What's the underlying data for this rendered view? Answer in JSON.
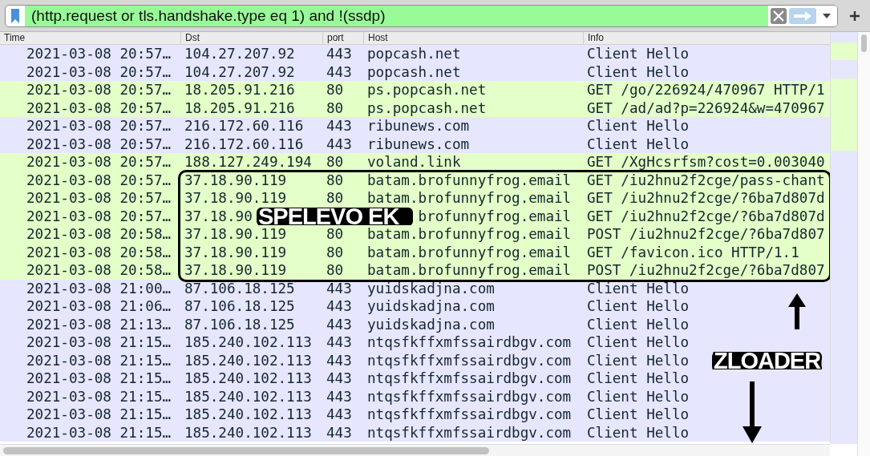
{
  "filter_bar": {
    "value": "(http.request or tls.handshake.type eq 1) and !(ssdp)"
  },
  "table": {
    "columns": [
      "Time",
      "Dst",
      "port",
      "Host",
      "Info"
    ],
    "rows": [
      {
        "color": "#e7e6ff",
        "cells": [
          "2021-03-08 20:57…",
          "104.27.207.92",
          "443",
          "popcash.net",
          "Client Hello"
        ]
      },
      {
        "color": "#e7e6ff",
        "cells": [
          "2021-03-08 20:57…",
          "104.27.207.92",
          "443",
          "popcash.net",
          "Client Hello"
        ]
      },
      {
        "color": "#e4ffc7",
        "cells": [
          "2021-03-08 20:57…",
          "18.205.91.216",
          "80",
          "ps.popcash.net",
          "GET /go/226924/470967 HTTP/1"
        ]
      },
      {
        "color": "#e4ffc7",
        "cells": [
          "2021-03-08 20:57…",
          "18.205.91.216",
          "80",
          "ps.popcash.net",
          "GET /ad/ad?p=226924&w=470967"
        ]
      },
      {
        "color": "#e7e6ff",
        "cells": [
          "2021-03-08 20:57…",
          "216.172.60.116",
          "443",
          "ribunews.com",
          "Client Hello"
        ]
      },
      {
        "color": "#e7e6ff",
        "cells": [
          "2021-03-08 20:57…",
          "216.172.60.116",
          "443",
          "ribunews.com",
          "Client Hello"
        ]
      },
      {
        "color": "#e4ffc7",
        "cells": [
          "2021-03-08 20:57…",
          "188.127.249.194",
          "80",
          "voland.link",
          "GET /XgHcsrfsm?cost=0.003040"
        ]
      },
      {
        "color": "#e4ffc7",
        "cells": [
          "2021-03-08 20:57…",
          "37.18.90.119",
          "80",
          "batam.brofunnyfrog.email",
          "GET /iu2hnu2f2cge/pass-chant"
        ]
      },
      {
        "color": "#e4ffc7",
        "cells": [
          "2021-03-08 20:57…",
          "37.18.90.119",
          "80",
          "batam.brofunnyfrog.email",
          "GET /iu2hnu2f2cge/?6ba7d807d"
        ]
      },
      {
        "color": "#e4ffc7",
        "cells": [
          "2021-03-08 20:57…",
          "37.18.90",
          null,
          "brofunnyfrog.email",
          "GET /iu2hnu2f2cge/?6ba7d807d"
        ]
      },
      {
        "color": "#e4ffc7",
        "cells": [
          "2021-03-08 20:58…",
          "37.18.90.119",
          "80",
          "batam.brofunnyfrog.email",
          "POST /iu2hnu2f2cge/?6ba7d807"
        ]
      },
      {
        "color": "#e4ffc7",
        "cells": [
          "2021-03-08 20:58…",
          "37.18.90.119",
          "80",
          "batam.brofunnyfrog.email",
          "GET /favicon.ico HTTP/1.1"
        ]
      },
      {
        "color": "#e4ffc7",
        "cells": [
          "2021-03-08 20:58…",
          "37.18.90.119",
          "80",
          "batam.brofunnyfrog.email",
          "POST /iu2hnu2f2cge/?6ba7d807"
        ]
      },
      {
        "color": "#e7e6ff",
        "cells": [
          "2021-03-08 21:00…",
          "87.106.18.125",
          "443",
          "yuidskadjna.com",
          "Client Hello"
        ]
      },
      {
        "color": "#e7e6ff",
        "cells": [
          "2021-03-08 21:06…",
          "87.106.18.125",
          "443",
          "yuidskadjna.com",
          "Client Hello"
        ]
      },
      {
        "color": "#e7e6ff",
        "cells": [
          "2021-03-08 21:13…",
          "87.106.18.125",
          "443",
          "yuidskadjna.com",
          "Client Hello"
        ]
      },
      {
        "color": "#e7e6ff",
        "cells": [
          "2021-03-08 21:15…",
          "185.240.102.113",
          "443",
          "ntqsfkffxmfssairdbgv.com",
          "Client Hello"
        ]
      },
      {
        "color": "#e7e6ff",
        "cells": [
          "2021-03-08 21:15…",
          "185.240.102.113",
          "443",
          "ntqsfkffxmfssairdbgv.com",
          "Client Hello"
        ]
      },
      {
        "color": "#e7e6ff",
        "cells": [
          "2021-03-08 21:15…",
          "185.240.102.113",
          "443",
          "ntqsfkffxmfssairdbgv.com",
          "Client Hello"
        ]
      },
      {
        "color": "#e7e6ff",
        "cells": [
          "2021-03-08 21:15…",
          "185.240.102.113",
          "443",
          "ntqsfkffxmfssairdbgv.com",
          "Client Hello"
        ]
      },
      {
        "color": "#e7e6ff",
        "cells": [
          "2021-03-08 21:15…",
          "185.240.102.113",
          "443",
          "ntqsfkffxmfssairdbgv.com",
          "Client Hello"
        ]
      },
      {
        "color": "#e7e6ff",
        "cells": [
          "2021-03-08 21:15…",
          "185.240.102.113",
          "443",
          "ntqsfkffxmfssairdbgv.com",
          "Client Hello"
        ]
      }
    ]
  },
  "annotations": [
    {
      "kind": "box_label",
      "text": "SPELEVO EK"
    },
    {
      "kind": "arrows_label",
      "text": "ZLOADER"
    }
  ]
}
